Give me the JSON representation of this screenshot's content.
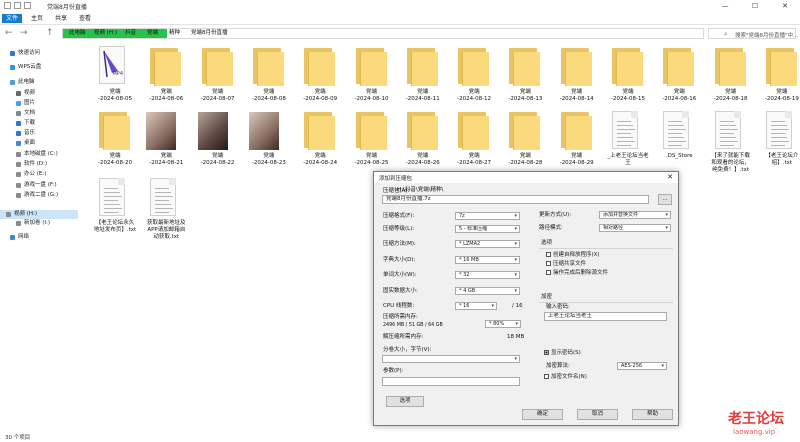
{
  "window": {
    "title": "党端8月份直播",
    "controls": [
      "—",
      "☐",
      "✕"
    ]
  },
  "ribbon": {
    "tabs": [
      "文件",
      "主页",
      "共享",
      "查看"
    ]
  },
  "address": {
    "nav": [
      "←",
      "→",
      "↑"
    ],
    "crumbs": [
      "此电脑",
      "视频 (H:)",
      "抖音",
      "党端",
      "精种",
      "党端8月份直播"
    ],
    "search_placeholder": "搜索\"党端8月份直播\"中..."
  },
  "sidebar": {
    "items": [
      {
        "label": "快速访问",
        "icon": "star-icon",
        "color": "#2f78d6"
      },
      {
        "label": "WPS云盘",
        "icon": "cloud-icon",
        "color": "#3a8fe0"
      },
      {
        "label": "此电脑",
        "icon": "computer-icon",
        "color": "#4aa0e6"
      },
      {
        "label": "视频",
        "icon": "video-icon",
        "color": "#6a6a6a"
      },
      {
        "label": "图片",
        "icon": "picture-icon",
        "color": "#4aa0e6"
      },
      {
        "label": "文档",
        "icon": "document-icon",
        "color": "#7a8a99"
      },
      {
        "label": "下载",
        "icon": "download-icon",
        "color": "#2f78d6"
      },
      {
        "label": "音乐",
        "icon": "music-icon",
        "color": "#2f78d6"
      },
      {
        "label": "桌面",
        "icon": "desktop-icon",
        "color": "#3b8ad9"
      },
      {
        "label": "本地磁盘 (C:)",
        "icon": "drive-icon",
        "color": "#8a8a8a"
      },
      {
        "label": "软件 (D:)",
        "icon": "drive-icon",
        "color": "#8a8a8a"
      },
      {
        "label": "办公 (E:)",
        "icon": "drive-icon",
        "color": "#8a8a8a"
      },
      {
        "label": "游戏一盘 (F:)",
        "icon": "drive-icon",
        "color": "#8a8a8a"
      },
      {
        "label": "游戏二盘 (G:)",
        "icon": "drive-icon",
        "color": "#8a8a8a"
      },
      {
        "label": "视频 (H:)",
        "icon": "drive-icon",
        "color": "#8a8a8a",
        "selected": true
      },
      {
        "label": "新加卷 (I:)",
        "icon": "drive-icon",
        "color": "#8a8a8a"
      },
      {
        "label": "网络",
        "icon": "network-icon",
        "color": "#3b8ad9"
      }
    ]
  },
  "files": [
    {
      "kind": "mp4",
      "name": "党端\n-2024-08-05"
    },
    {
      "kind": "folder",
      "name": "党端\n-2024-08-06"
    },
    {
      "kind": "folder",
      "name": "党端\n-2024-08-07"
    },
    {
      "kind": "folder",
      "name": "党端\n-2024-08-08"
    },
    {
      "kind": "folder",
      "name": "党端\n-2024-08-09"
    },
    {
      "kind": "folder",
      "name": "党端\n-2024-08-10"
    },
    {
      "kind": "folder",
      "name": "党端\n-2024-08-11"
    },
    {
      "kind": "folder",
      "name": "党端\n-2024-08-12"
    },
    {
      "kind": "folder",
      "name": "党端\n-2024-08-13"
    },
    {
      "kind": "folder",
      "name": "党端\n-2024-08-14"
    },
    {
      "kind": "folder",
      "name": "党端\n-2024-08-15"
    },
    {
      "kind": "folder",
      "name": "党端\n-2024-08-16"
    },
    {
      "kind": "folder",
      "name": "党端\n-2024-08-18"
    },
    {
      "kind": "folder",
      "name": "党端\n-2024-08-19"
    },
    {
      "kind": "folder",
      "name": "党端\n-2024-08-20"
    },
    {
      "kind": "photo",
      "name": "党端\n-2024-08-21"
    },
    {
      "kind": "photo",
      "name": "党端\n-2024-08-22"
    },
    {
      "kind": "photo",
      "name": "党端\n-2024-08-23"
    },
    {
      "kind": "folder",
      "name": "党端\n-2024-08-24"
    },
    {
      "kind": "folder",
      "name": "党端\n-2024-08-25"
    },
    {
      "kind": "folder",
      "name": "党端\n-2024-08-26"
    },
    {
      "kind": "folder",
      "name": "党端\n-2024-08-27"
    },
    {
      "kind": "folder",
      "name": "党端\n-2024-08-28"
    },
    {
      "kind": "folder",
      "name": "党端\n-2024-08-29"
    },
    {
      "kind": "doc",
      "name": "_上老王论坛当老\n王"
    },
    {
      "kind": "doc",
      "name": ".DS_Store"
    },
    {
      "kind": "doc",
      "name": "【来了就能下载\n和观看的论坛，\n纯免费！】.txt"
    },
    {
      "kind": "doc",
      "name": "【老王论坛介\n绍】.txt"
    },
    {
      "kind": "doc",
      "name": "【老王论坛永久\n地址发布页】.txt"
    },
    {
      "kind": "doc",
      "name": "获取最新地址及\nAPP请加邮箱自\n动获取.txt"
    }
  ],
  "dialog": {
    "title": "添加到压缩包",
    "close": "✕",
    "archive_label": "压缩包(A):",
    "archive_path_hint": "H:\\抖音\\党端\\精种\\",
    "archive_name": "党端8月份直播.7z",
    "browse_label": "...",
    "left": [
      {
        "label": "压缩格式(F):",
        "value": "7z"
      },
      {
        "label": "压缩等级(L):",
        "value": "5 - 标准压缩"
      },
      {
        "label": "压缩方法(M):",
        "value": "* LZMA2"
      },
      {
        "label": "字典大小(D):",
        "value": "* 16 MB"
      },
      {
        "label": "单词大小(W):",
        "value": "* 32"
      },
      {
        "label": "固实数据大小:",
        "value": "* 4 GB"
      },
      {
        "label": "CPU 线程数:",
        "value": "* 16"
      }
    ],
    "threads_total": "/ 16",
    "mem_label": "压缩所需内存:",
    "mem_detail": "2496 MB / 51 GB / 64 GB",
    "mem_percent": "* 80%",
    "decomp_label": "解压缩所需内存:",
    "decomp_value": "18 MB",
    "split_label": "分卷大小，字节(V):",
    "params_label": "参数(P):",
    "options_button": "选项",
    "right": {
      "update_label": "更新方式(U):",
      "update_value": "添加并替换文件",
      "path_label": "路径模式:",
      "path_value": "相对路径",
      "options_group": "选项",
      "checks": [
        {
          "label": "创建自释放程序(X)",
          "checked": false
        },
        {
          "label": "压缩共享文件",
          "checked": false
        },
        {
          "label": "操作完成后删除源文件",
          "checked": false
        }
      ],
      "encrypt_group": "加密",
      "password_label": "输入密码:",
      "password_value": "上老王论坛当老王",
      "show_password": {
        "label": "显示密码(S)",
        "checked": true
      },
      "enc_method_label": "加密算法:",
      "enc_method_value": "AES-256",
      "encrypt_names": {
        "label": "加密文件名(N)",
        "checked": false
      }
    },
    "buttons": [
      "确定",
      "取消",
      "帮助"
    ]
  },
  "status": {
    "count": "30 个项目"
  },
  "watermark": {
    "line1": "老王论坛",
    "line2": "laowang.vip"
  }
}
